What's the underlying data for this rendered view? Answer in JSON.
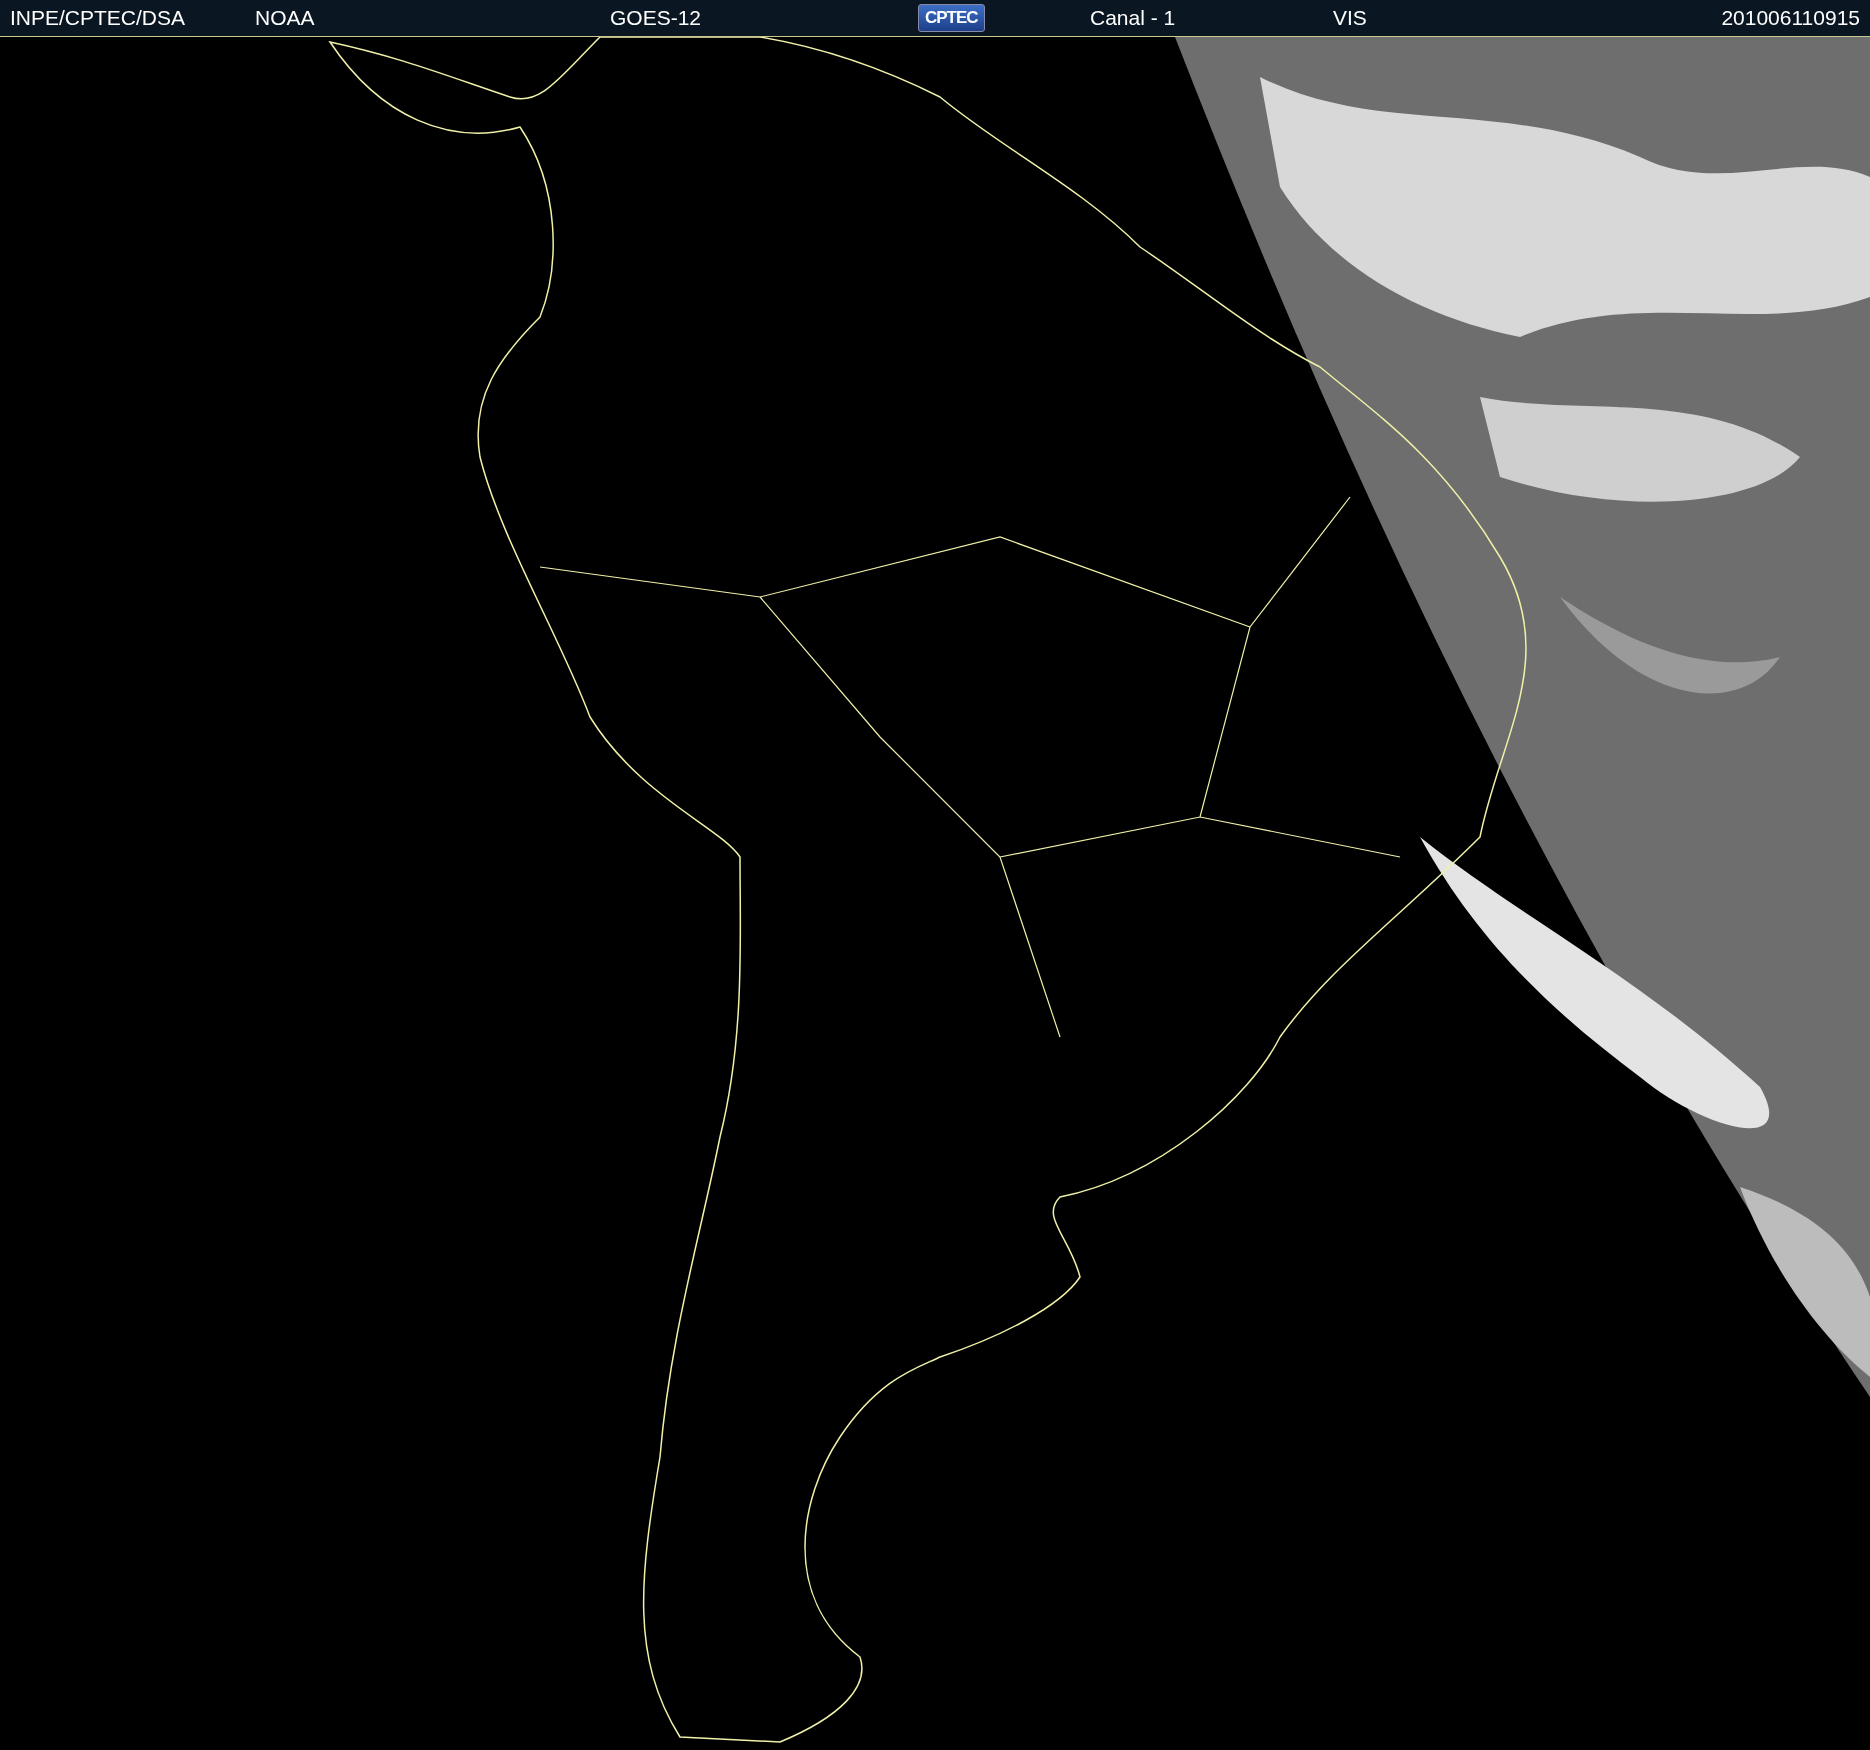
{
  "header": {
    "items": [
      {
        "kind": "text",
        "text": "INPE/CPTEC/DSA"
      },
      {
        "kind": "text",
        "text": "NOAA"
      },
      {
        "kind": "text",
        "text": "GOES-12"
      },
      {
        "kind": "logo",
        "text": "CPTEC"
      },
      {
        "kind": "text",
        "text": "Canal - 1"
      },
      {
        "kind": "text",
        "text": "VIS"
      },
      {
        "kind": "text",
        "text": "201006110915"
      }
    ]
  }
}
